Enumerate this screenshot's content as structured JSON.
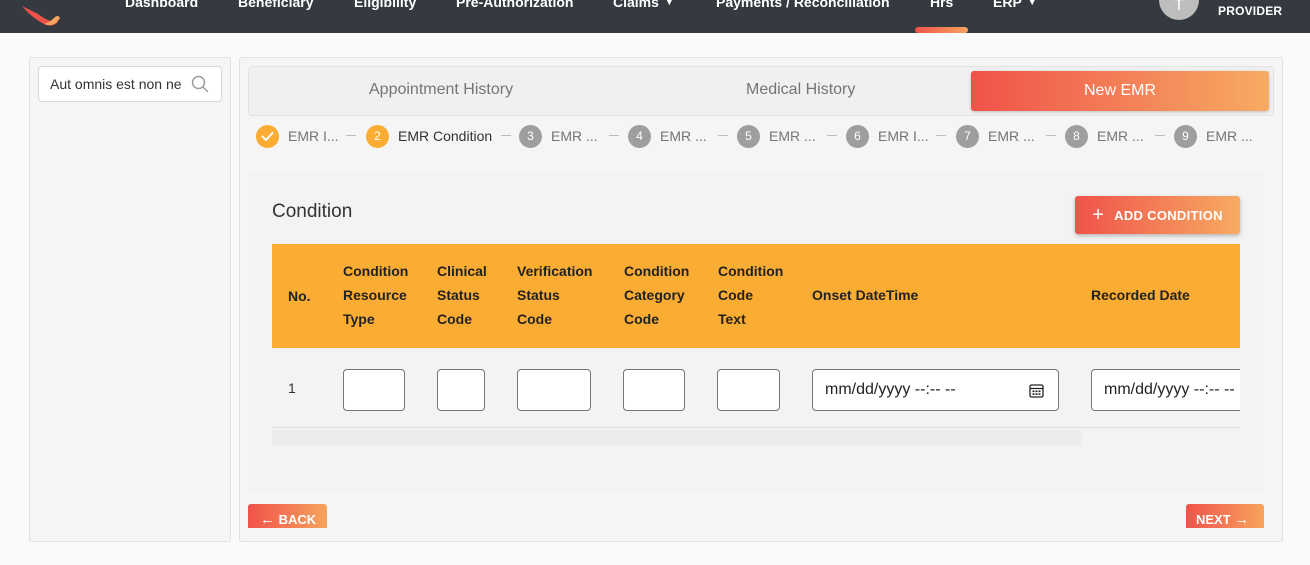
{
  "navbar": {
    "items": [
      {
        "label": "Dashboard",
        "has_caret": false
      },
      {
        "label": "Beneficiary",
        "has_caret": false
      },
      {
        "label": "Eligibility",
        "has_caret": false
      },
      {
        "label": "Pre-Authorization",
        "has_caret": false
      },
      {
        "label": "Claims",
        "has_caret": true
      },
      {
        "label": "Payments / Reconciliation",
        "has_caret": false
      },
      {
        "label": "Hrs",
        "has_caret": false,
        "active": true
      },
      {
        "label": "ERP",
        "has_caret": true
      }
    ],
    "avatar_initial": "T",
    "role": "PROVIDER",
    "background_color": "#343a40",
    "accent_gradient": [
      "#f0524a",
      "#f7a45e"
    ]
  },
  "sidebar": {
    "search": {
      "value": "Aut omnis est non ne",
      "icon": "search-icon"
    }
  },
  "tabs": [
    {
      "label": "Appointment History",
      "active": false
    },
    {
      "label": "Medical History",
      "active": false
    },
    {
      "label": "New EMR",
      "active": true
    }
  ],
  "stepper": [
    {
      "number": "1",
      "label": "EMR I...",
      "state": "done"
    },
    {
      "number": "2",
      "label": "EMR Condition",
      "state": "active"
    },
    {
      "number": "3",
      "label": "EMR ...",
      "state": "pending"
    },
    {
      "number": "4",
      "label": "EMR ...",
      "state": "pending"
    },
    {
      "number": "5",
      "label": "EMR ...",
      "state": "pending"
    },
    {
      "number": "6",
      "label": "EMR I...",
      "state": "pending"
    },
    {
      "number": "7",
      "label": "EMR ...",
      "state": "pending"
    },
    {
      "number": "8",
      "label": "EMR ...",
      "state": "pending"
    },
    {
      "number": "9",
      "label": "EMR ...",
      "state": "pending"
    }
  ],
  "condition": {
    "title": "Condition",
    "add_button": "ADD CONDITION",
    "table": {
      "header_color": "#fbac32",
      "columns": [
        [
          "No."
        ],
        [
          "Condition",
          "Resource",
          "Type"
        ],
        [
          "Clinical",
          "Status",
          "Code"
        ],
        [
          "Verification",
          "Status",
          "Code"
        ],
        [
          "Condition",
          "Category",
          "Code"
        ],
        [
          "Condition",
          "Code",
          "Text"
        ],
        [
          "Onset DateTime"
        ],
        [
          "Recorded Date"
        ]
      ],
      "rows": [
        {
          "no": "1",
          "condition_resource_type": "",
          "clinical_status_code": "",
          "verification_status_code": "",
          "condition_category_code": "",
          "condition_code_text": "",
          "onset_datetime_placeholder": "mm/dd/yyyy --:-- --",
          "recorded_date_placeholder": "mm/dd/yyyy --:-- --"
        }
      ]
    }
  },
  "footer": {
    "back_label": "BACK",
    "next_label": "NEXT"
  }
}
